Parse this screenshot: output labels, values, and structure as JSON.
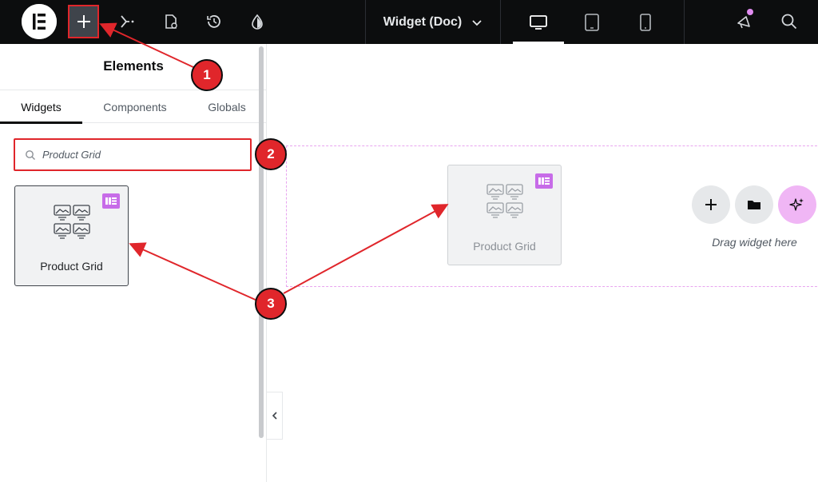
{
  "topbar": {
    "logo_icon": "elementor-logo-icon",
    "add_icon": "plus-icon",
    "doc_title": "Widget (Doc)",
    "accent": "#e0262b"
  },
  "panel": {
    "title": "Elements",
    "tabs": [
      {
        "label": "Widgets"
      },
      {
        "label": "Components"
      },
      {
        "label": "Globals"
      }
    ],
    "search": {
      "value": "Product Grid"
    },
    "widget": {
      "label": "Product Grid"
    }
  },
  "canvas": {
    "ghost_widget": {
      "label": "Product Grid"
    },
    "drag_text": "Drag widget here"
  },
  "annotations": {
    "badge_1": "1",
    "badge_2": "2",
    "badge_3": "3"
  }
}
